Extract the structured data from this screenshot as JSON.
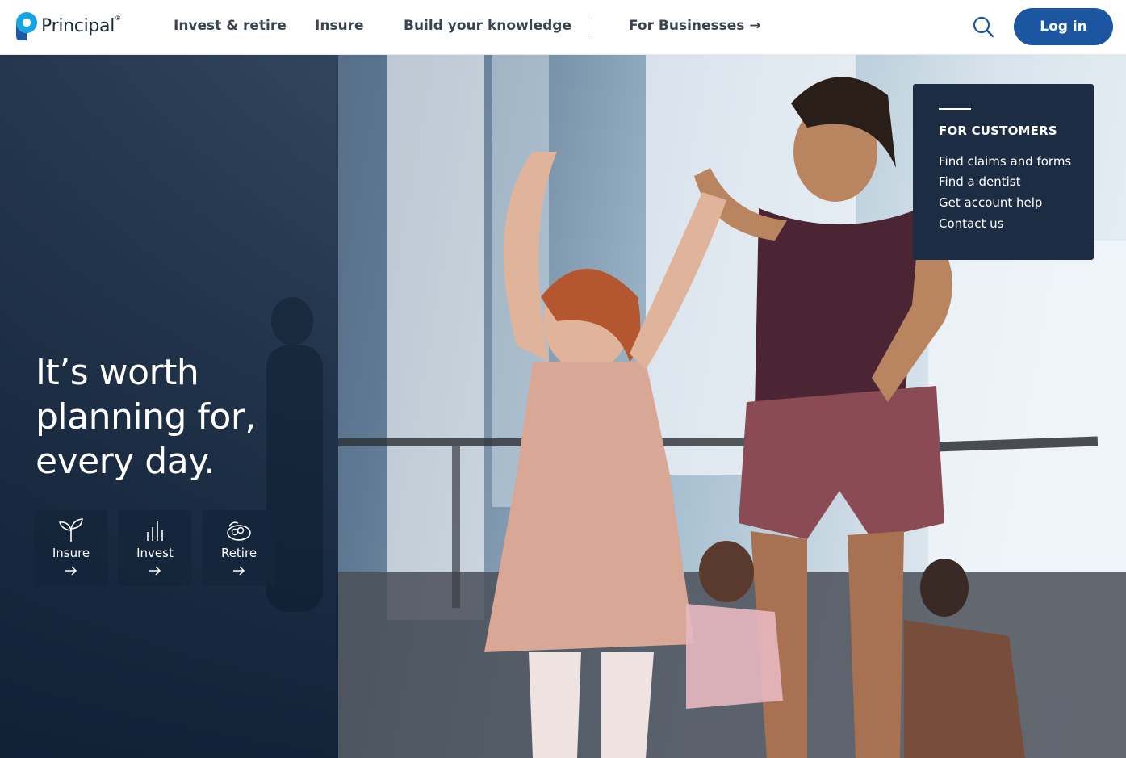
{
  "header": {
    "brand": "Principal",
    "brand_mark": "®",
    "nav": [
      {
        "label": "Invest & retire"
      },
      {
        "label": "Insure"
      },
      {
        "label": "Build your knowledge"
      },
      {
        "label": "For Businesses →"
      }
    ],
    "search_icon": "search-icon",
    "login_label": "Log in"
  },
  "hero": {
    "headline_lines": [
      "It’s worth",
      "planning for,",
      "every day."
    ],
    "tiles": [
      {
        "label": "Insure",
        "icon": "sprout-icon"
      },
      {
        "label": "Invest",
        "icon": "bar-chart-icon"
      },
      {
        "label": "Retire",
        "icon": "nest-icon"
      }
    ]
  },
  "customers": {
    "title": "FOR CUSTOMERS",
    "links": [
      "Find claims and forms",
      "Find a dentist",
      "Get account help",
      "Contact us"
    ]
  },
  "colors": {
    "brand_blue": "#1c55a0",
    "panel_navy": "#1c2c42",
    "logo_cyan": "#16a5e0",
    "logo_blue": "#1d58a5"
  }
}
